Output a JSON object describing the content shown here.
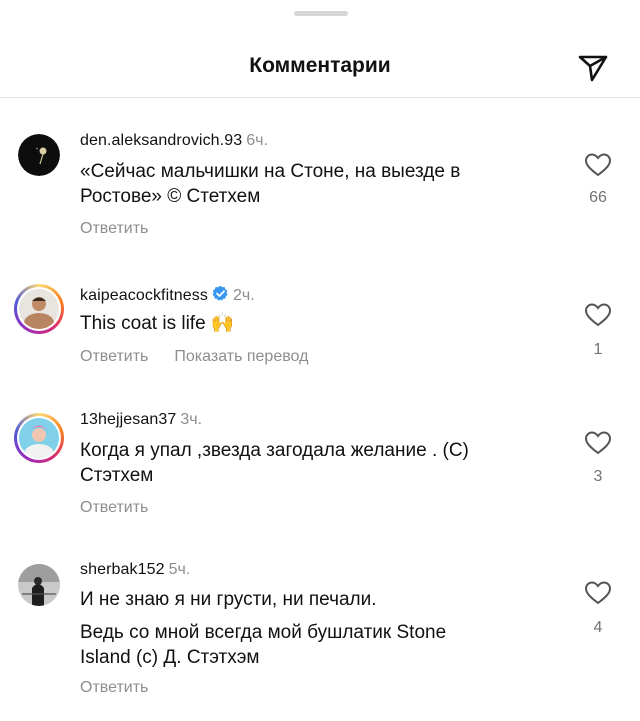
{
  "header": {
    "title": "Комментарии"
  },
  "icons": {
    "send": "send-icon",
    "like": "heart-icon",
    "verified": "verified-badge-icon"
  },
  "colors": {
    "verified": "#3897f0",
    "muted": "#8e8e8e",
    "ring": "#d62976"
  },
  "comments": [
    {
      "username": "den.aleksandrovich.93",
      "time": "6ч.",
      "lines": [
        "«Сейчас мальчишки на Стоне, на выезде в",
        "Ростове» © Стетхем"
      ],
      "likes": "66",
      "reply": "Ответить"
    },
    {
      "username": "kaipeacockfitness",
      "time": "2ч.",
      "verified": true,
      "lines": [
        "This coat is life 🙌"
      ],
      "likes": "1",
      "reply": "Ответить",
      "translate": "Показать перевод"
    },
    {
      "username": "13hejjesan37",
      "time": "3ч.",
      "lines": [
        "Когда я упал ,звезда загодала желание . (С)",
        "Стэтхем"
      ],
      "likes": "3",
      "reply": "Ответить"
    },
    {
      "username": "sherbak152",
      "time": "5ч.",
      "lines": [
        "И не знаю я ни грусти, ни печали.",
        "Ведь со мной всегда мой бушлатик Stone",
        "Island (с) Д. Стэтхэм"
      ],
      "likes": "4",
      "reply": "Ответить"
    }
  ]
}
